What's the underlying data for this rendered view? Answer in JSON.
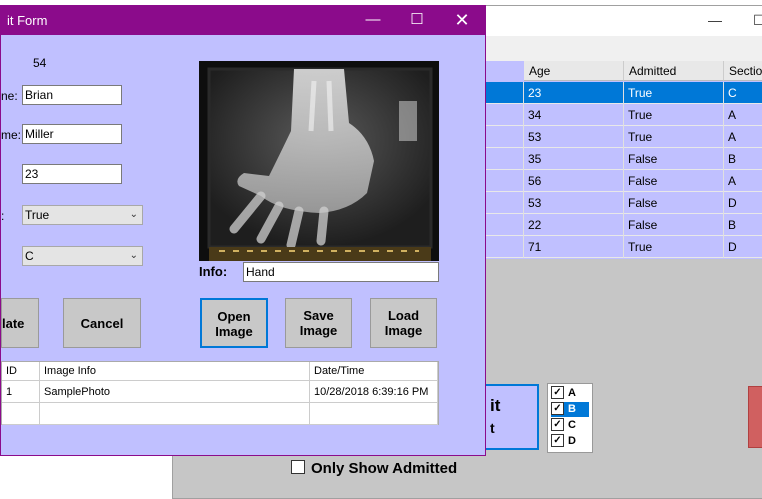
{
  "bg_window": {
    "grid": {
      "columns": [
        "Age",
        "Admitted",
        "Section"
      ],
      "rows": [
        {
          "age": "23",
          "admitted": "True",
          "section": "C"
        },
        {
          "age": "34",
          "admitted": "True",
          "section": "A"
        },
        {
          "age": "53",
          "admitted": "True",
          "section": "A"
        },
        {
          "age": "35",
          "admitted": "False",
          "section": "B"
        },
        {
          "age": "56",
          "admitted": "False",
          "section": "A"
        },
        {
          "age": "53",
          "admitted": "False",
          "section": "D"
        },
        {
          "age": "22",
          "admitted": "False",
          "section": "B"
        },
        {
          "age": "71",
          "admitted": "True",
          "section": "D"
        }
      ]
    },
    "edit_button_partial": "it",
    "edit_button_partial2": "t",
    "sections": [
      "A",
      "B",
      "C",
      "D"
    ],
    "only_admitted_label": "Only Show Admitted"
  },
  "dialog": {
    "title": "it Form",
    "id_value": "54",
    "labels": {
      "first": "ne:",
      "last": "me:",
      "admitted": ":"
    },
    "first_name": "Brian",
    "last_name": "Miller",
    "age": "23",
    "admitted": "True",
    "section": "C",
    "info_label": "Info:",
    "info_value": "Hand",
    "buttons": {
      "update": "late",
      "cancel": "Cancel",
      "open_l1": "Open",
      "open_l2": "Image",
      "save_l1": "Save",
      "save_l2": "Image",
      "load_l1": "Load",
      "load_l2": "Image"
    },
    "grid": {
      "headers": [
        "ID",
        "Image Info",
        "Date/Time"
      ],
      "rows": [
        {
          "id": "1",
          "info": "SamplePhoto",
          "datetime": "10/28/2018 6:39:16 PM"
        }
      ]
    }
  }
}
